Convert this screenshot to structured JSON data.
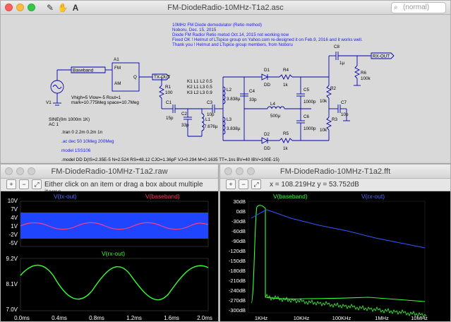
{
  "main_window": {
    "title": "FM-DiodeRadio-10MHz-T1a2.asc",
    "search_placeholder": "(normal)",
    "tools": [
      "pencil-icon",
      "hand-icon",
      "text-A-icon"
    ]
  },
  "schematic": {
    "header_lines": [
      "10MHz FM Diode demodulator (Retio method)",
      "Noboru, Dec. 15, 2015",
      "Diode FM Radio/ Retio metod Oct.14, 2015 not working now",
      "Fixed OK ! Helmut of LTspice group on Yahoo.com re-designed it on Feb.9, 2016 and it works well.",
      "Thank you ! Helmut and LTspice group members, from Noboru"
    ],
    "labels": {
      "baseband": "Baseband",
      "tx_out": "TX-OUT",
      "rx_out": "RX-OUT",
      "a1": "A1",
      "fm": "FM",
      "am": "AM",
      "q": "Q",
      "a1_params": "Vhigh=5 Vlow=-5 Rout=1",
      "a1_params2": "mark=10.775Meg space=10.7Meg",
      "v1": "V1",
      "v1_sine": "SINE(0m 1000m 1K)",
      "v1_ac": "AC 1",
      "r1": "R1",
      "r1_val": "100",
      "c1": "C1",
      "c1_val": "15p",
      "c2": "C2",
      "c2_val": "33p",
      "l1": "L1",
      "l1_val": "7.676µ",
      "c3": "C3",
      "c3_val": "10p",
      "k1": "K1 L1 L2 0.5",
      "k2": "K2 L1 L3 0.5",
      "k3": "K3 L2 L3 0.9",
      "l2": "L2",
      "l2_val": "3.838µ",
      "l3": "L3",
      "l3_val": "3.838µ",
      "c4": "C4",
      "c4_val": "33p",
      "l4": "L4",
      "l4_val": "500µ",
      "d1": "D1",
      "d1_val": "DD",
      "d2": "D2",
      "d2_val": "DD",
      "r4": "R4",
      "r4_val": "1k",
      "r5": "R5",
      "r5_val": "1k",
      "c5": "C5",
      "c5_val": "1000p",
      "c6": "C6",
      "c6_val": "1000p",
      "r2": "R2",
      "r2_val": "10k",
      "r3": "R3",
      "r3_val": "10k",
      "c7": "C7",
      "c7_val": "10p",
      "c8": "C8",
      "c8_val": "1µ",
      "r6": "R6",
      "r6_val": "100k"
    },
    "directives": [
      ".tran 0 2.2m 0.2m 1n",
      ".ac dec 50 10Meg 200Meg",
      "model 1SS106",
      ".model DD D(IS=2.35E-5 N=2.524 RS=48.12 CJO=1.36pF VJ=0.294 M=0.1635 TT=.1ns BV=40 IBV=100E-15)"
    ]
  },
  "waveform_window": {
    "title": "FM-DiodeRadio-10MHz-T1a2.raw",
    "hint": "Either click on an item or drag a box about multiple items.",
    "top_pane": {
      "traces": [
        {
          "name": "V(tx-out)",
          "color": "#0000ff"
        },
        {
          "name": "V(baseband)",
          "color": "#ff3366"
        }
      ],
      "y_ticks": [
        "10V",
        "7V",
        "4V",
        "1V",
        "-2V",
        "-5V"
      ]
    },
    "bottom_pane": {
      "traces": [
        {
          "name": "V(rx-out)",
          "color": "#00ff00"
        }
      ],
      "y_ticks": [
        "9.2V",
        "8.1V",
        "7.0V"
      ]
    },
    "x_ticks": [
      "0.0ms",
      "0.4ms",
      "0.8ms",
      "1.2ms",
      "1.6ms",
      "2.0ms"
    ]
  },
  "spectrum_window": {
    "title": "FM-DiodeRadio-10MHz-T1a2.fft",
    "readout": "x = 108.219Hz    y = 53.752dB",
    "traces": [
      {
        "name": "V(baseband)",
        "color": "#00ff00"
      },
      {
        "name": "V(rx-out)",
        "color": "#0000ff"
      }
    ],
    "y_ticks": [
      "30dB",
      "0dB",
      "-30dB",
      "-60dB",
      "-90dB",
      "-120dB",
      "-150dB",
      "-180dB",
      "-210dB",
      "-240dB",
      "-270dB",
      "-300dB"
    ],
    "x_ticks": [
      "1KHz",
      "10KHz",
      "100KHz",
      "1MHz",
      "10MHz"
    ]
  }
}
